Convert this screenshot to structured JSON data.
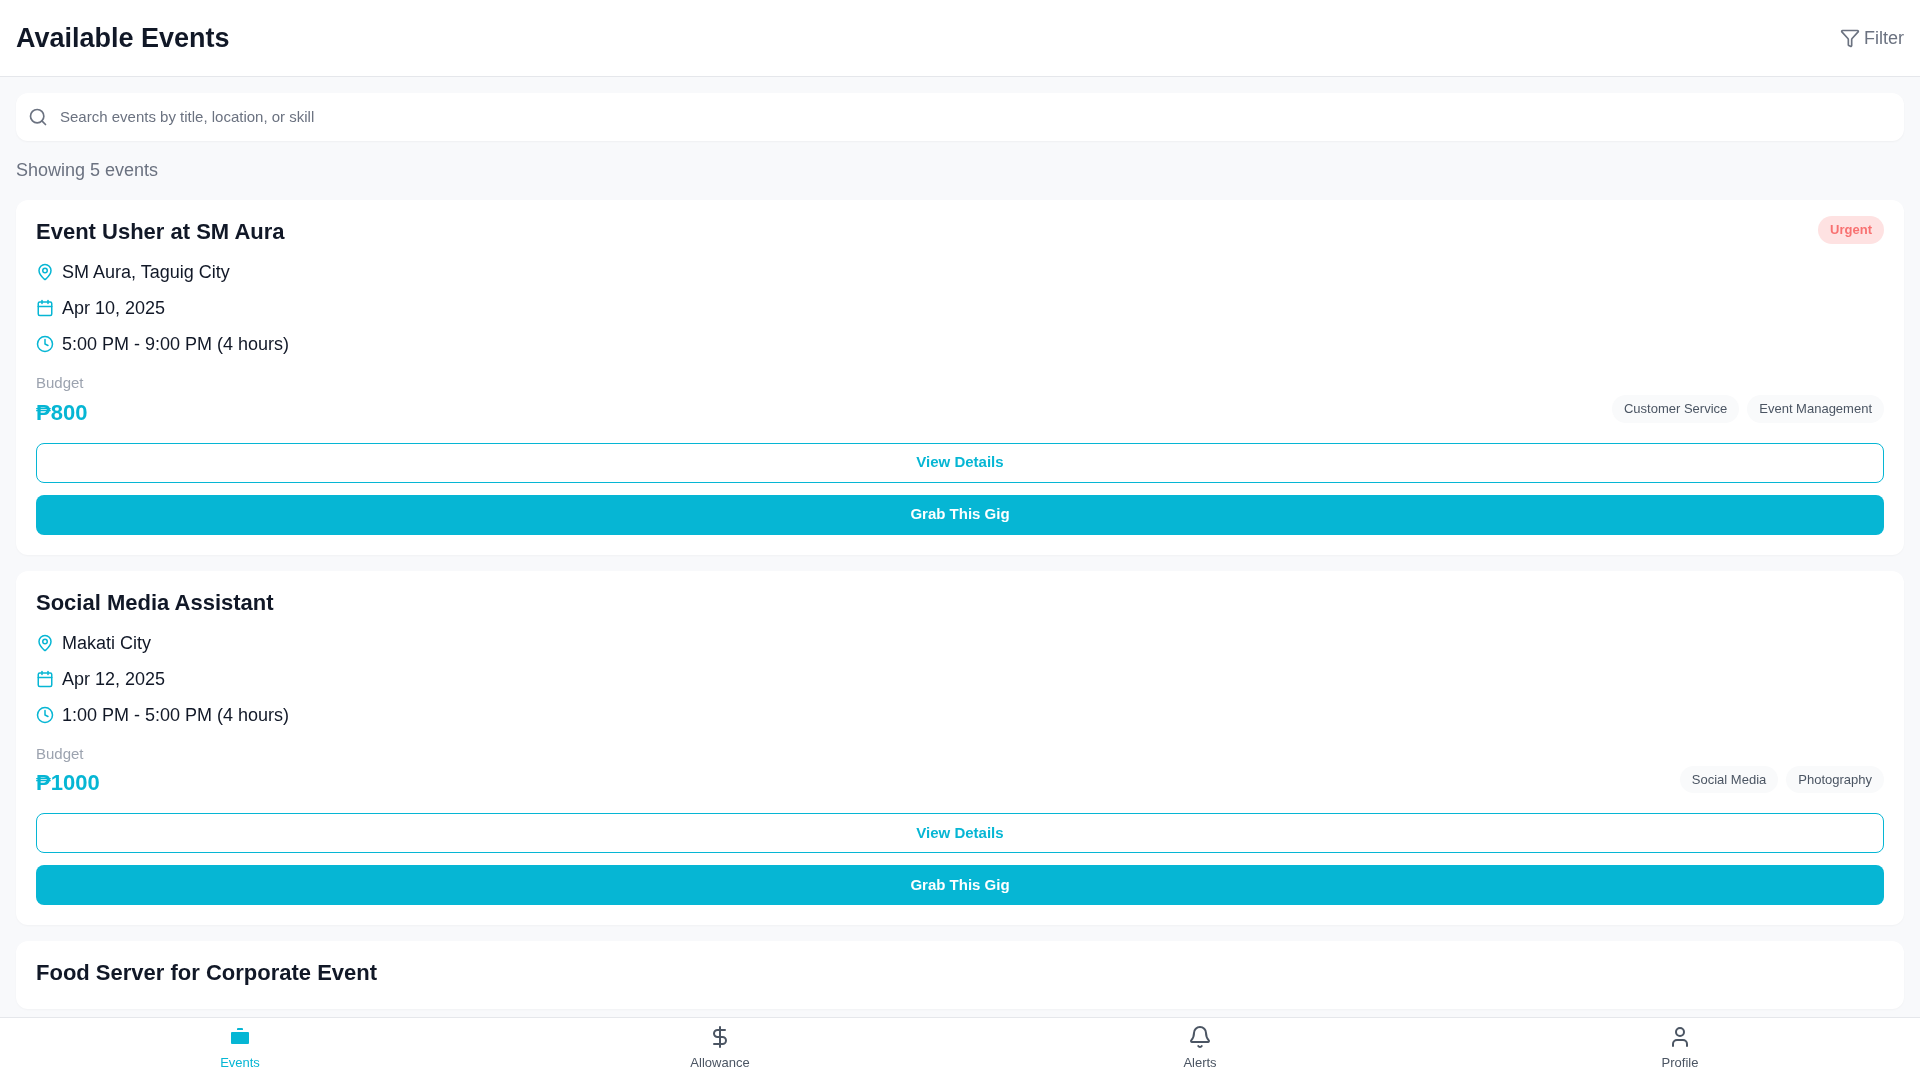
{
  "header": {
    "title": "Available Events",
    "filter_label": "Filter"
  },
  "search": {
    "placeholder": "Search events by title, location, or skill"
  },
  "count_text": "Showing 5 events",
  "events": [
    {
      "title": "Event Usher at SM Aura",
      "urgent": true,
      "urgent_label": "Urgent",
      "location": "SM Aura, Taguig City",
      "date": "Apr 10, 2025",
      "time": "5:00 PM - 9:00 PM (4 hours)",
      "budget_label": "Budget",
      "budget": "₱800",
      "tags": [
        "Customer Service",
        "Event Management"
      ],
      "details_label": "View Details",
      "grab_label": "Grab This Gig"
    },
    {
      "title": "Social Media Assistant",
      "urgent": false,
      "location": "Makati City",
      "date": "Apr 12, 2025",
      "time": "1:00 PM - 5:00 PM (4 hours)",
      "budget_label": "Budget",
      "budget": "₱1000",
      "tags": [
        "Social Media",
        "Photography"
      ],
      "details_label": "View Details",
      "grab_label": "Grab This Gig"
    },
    {
      "title": "Food Server for Corporate Event",
      "urgent": false
    }
  ],
  "nav": [
    {
      "label": "Events",
      "kind": "events",
      "selected": true
    },
    {
      "label": "Allowance",
      "kind": "allowance",
      "selected": false
    },
    {
      "label": "Alerts",
      "kind": "alerts",
      "selected": false
    },
    {
      "label": "Profile",
      "kind": "profile",
      "selected": false
    }
  ]
}
